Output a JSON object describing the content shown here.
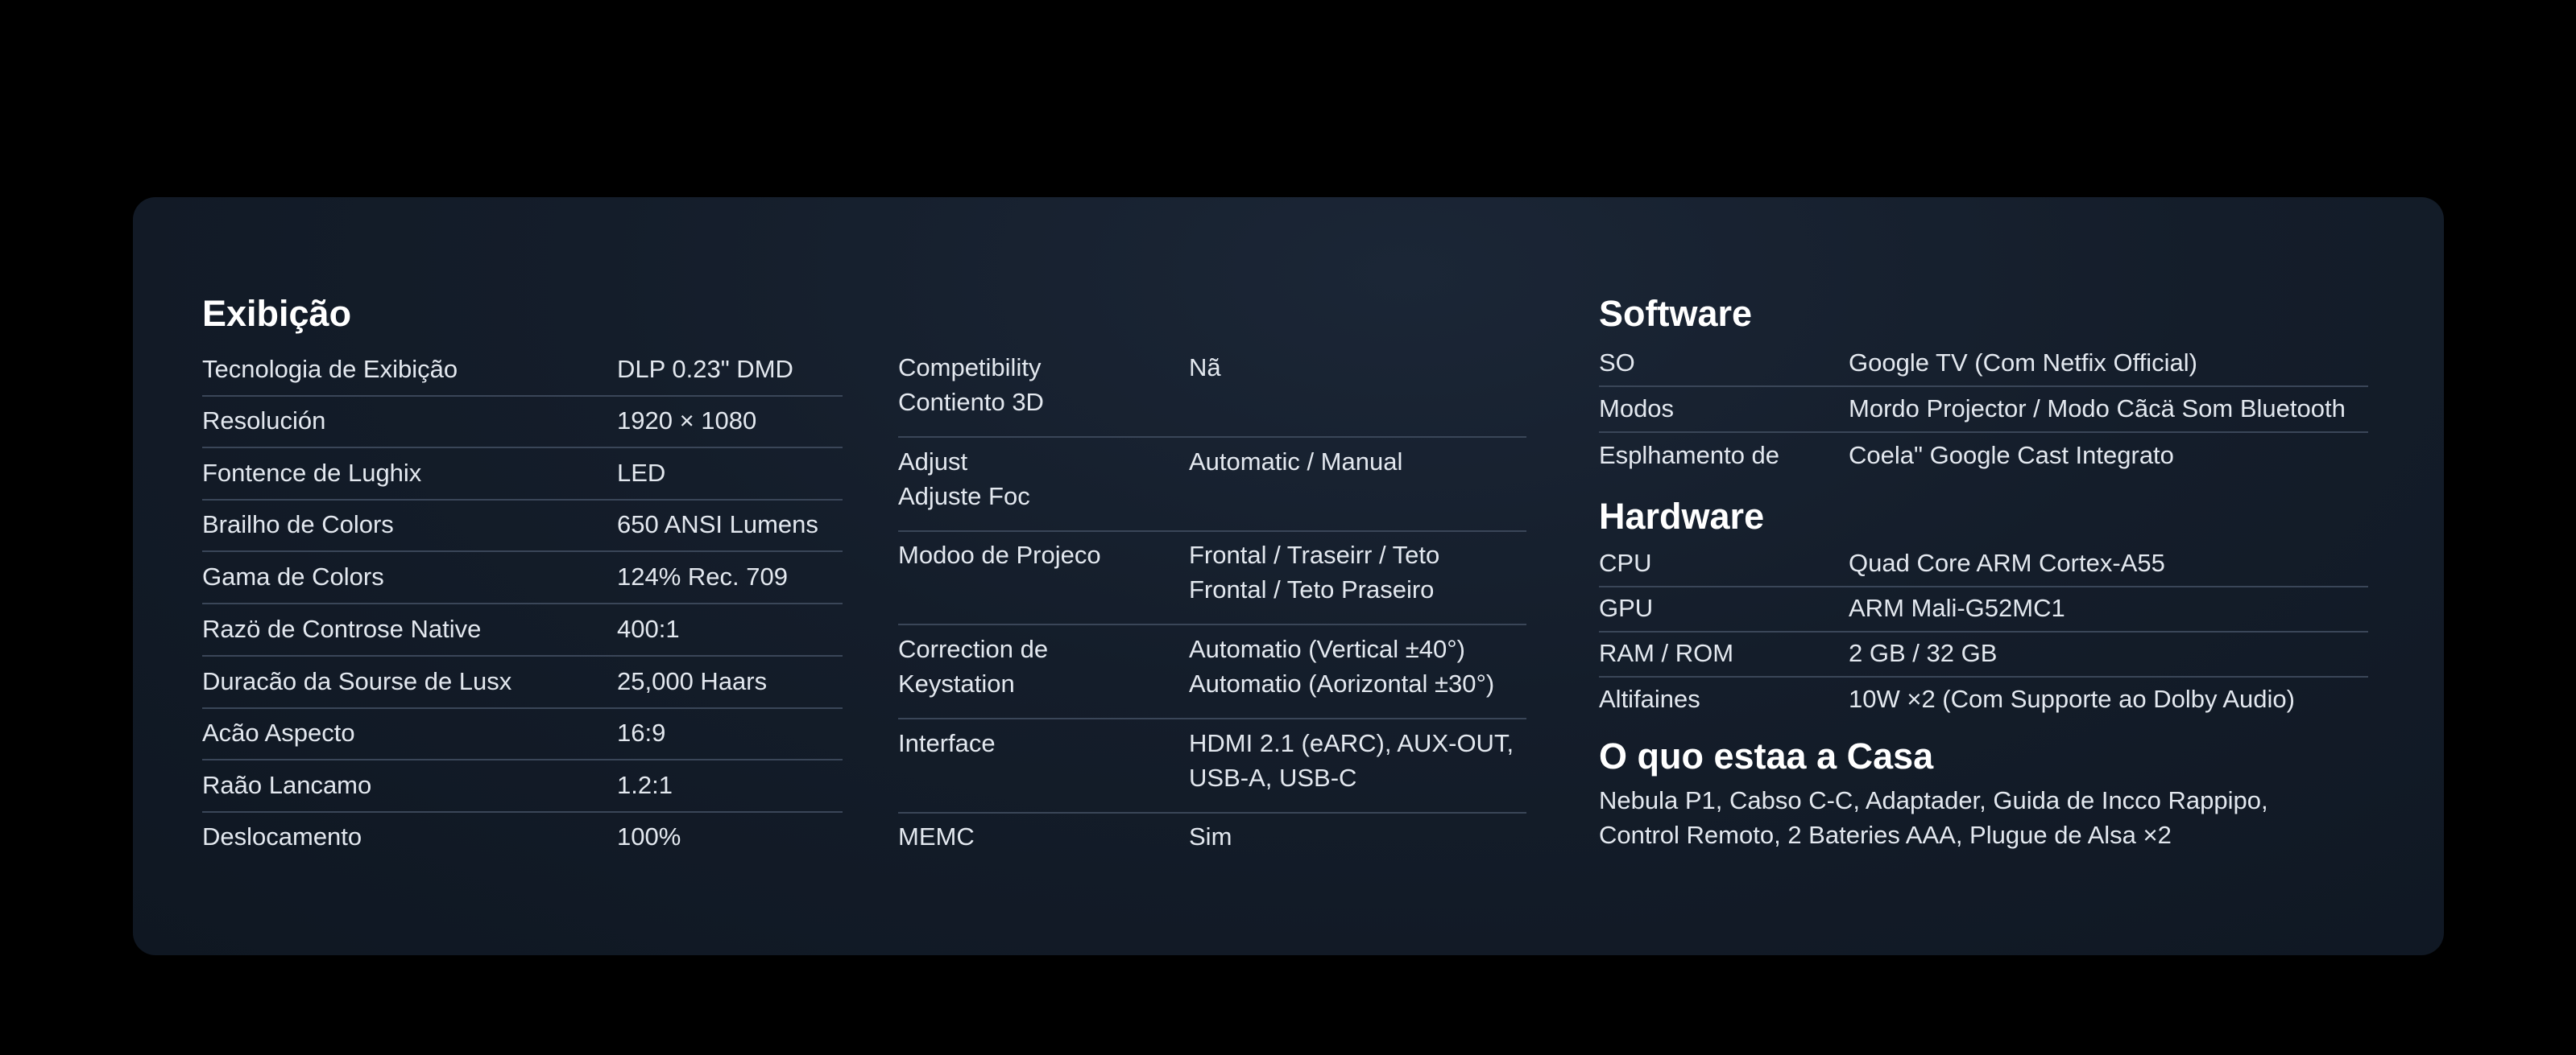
{
  "display": {
    "title": "Exibição",
    "rows": [
      {
        "label": "Tecnologia de Exibição",
        "value": "DLP 0.23\" DMD"
      },
      {
        "label": "Resolución",
        "value": "1920 × 1080"
      },
      {
        "label": "Fontence de Lughix",
        "value": "LED"
      },
      {
        "label": "Brailho de Colors",
        "value": "650 ANSI Lumens"
      },
      {
        "label": "Gama de Colors",
        "value": "124% Rec. 709"
      },
      {
        "label": "Razö de Controse Native",
        "value": "400:1"
      },
      {
        "label": "Duracão da Sourse de Lusx",
        "value": "25,000 Haars"
      },
      {
        "label": "Acão Aspecto",
        "value": "16:9"
      },
      {
        "label": "Raão Lancamo",
        "value": "1.2:1"
      },
      {
        "label": "Deslocamento",
        "value": "100%"
      }
    ]
  },
  "features": {
    "rows": [
      {
        "label": "Competibility\nContiento 3D",
        "value": "Nã"
      },
      {
        "label": "Adjust\nAdjuste Foc",
        "value": "Automatic / Manual"
      },
      {
        "label": "Modoo de Projeco",
        "value": "Frontal / Traseirr / Teto\nFrontal / Teto Praseiro"
      },
      {
        "label": "Correction de\nKeystation",
        "value": "Automatio (Vertical ±40°)\nAutomatio (Aorizontal ±30°)"
      },
      {
        "label": "Interface",
        "value": "HDMI 2.1 (eARC), AUX-OUT,\nUSB-A, USB-C"
      },
      {
        "label": "MEMC",
        "value": "Sim"
      }
    ]
  },
  "software": {
    "title": "Software",
    "rows": [
      {
        "label": "SO",
        "value": "Google TV (Com Netfix Official)"
      },
      {
        "label": "Modos",
        "value": "Mordo Projector / Modo Cãcä Som Bluetooth"
      },
      {
        "label": "Esplhamento de",
        "value": "Coela\" Google Cast Integrato"
      }
    ]
  },
  "hardware": {
    "title": "Hardware",
    "rows": [
      {
        "label": "CPU",
        "value": "Quad Core ARM Cortex-A55"
      },
      {
        "label": "GPU",
        "value": "ARM Mali-G52MC1"
      },
      {
        "label": "RAM / ROM",
        "value": "2 GB / 32 GB"
      },
      {
        "label": "Altifaines",
        "value": "10W ×2 (Com Supporte ao Dolby Audio)"
      }
    ]
  },
  "in_the_box": {
    "title": "O quo estaa a Casa",
    "text": "Nebula P1, Cabso C-C, Adaptader, Guida de Incco Rappipo,\nControl Remoto, 2 Bateries AAA, Plugue de Alsa ×2"
  }
}
